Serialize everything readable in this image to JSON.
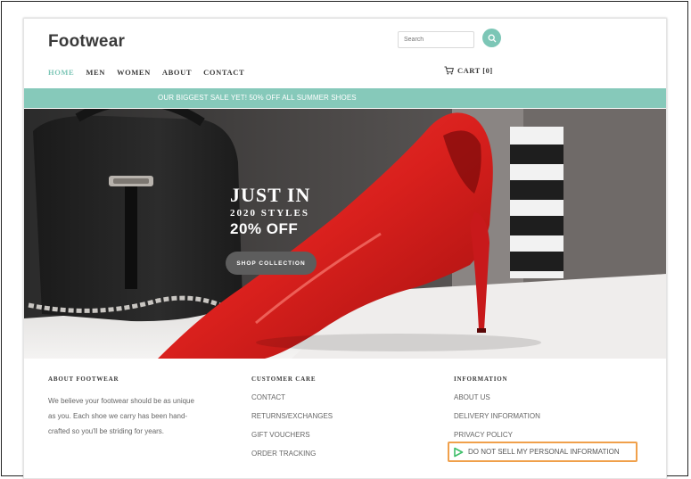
{
  "header": {
    "brand": "Footwear",
    "search_placeholder": "Search",
    "nav": [
      "HOME",
      "MEN",
      "WOMEN",
      "ABOUT",
      "CONTACT"
    ],
    "cart_label": "CART [0]"
  },
  "promo": {
    "text": "OUR BIGGEST SALE YET! 50% OFF ALL SUMMER SHOES"
  },
  "hero": {
    "title": "JUST IN",
    "subtitle": "2020 STYLES",
    "discount": "20% OFF",
    "cta": "SHOP COLLECTION"
  },
  "footer": {
    "about": {
      "heading": "ABOUT FOOTWEAR",
      "lines": [
        "We believe your footwear should be as unique",
        "as you. Each shoe we carry has been hand-",
        "crafted so you'll be striding for years."
      ]
    },
    "customer_care": {
      "heading": "CUSTOMER CARE",
      "links": [
        "CONTACT",
        "RETURNS/EXCHANGES",
        "GIFT VOUCHERS",
        "ORDER TRACKING"
      ]
    },
    "information": {
      "heading": "INFORMATION",
      "links": [
        "ABOUT US",
        "DELIVERY INFORMATION",
        "PRIVACY POLICY"
      ],
      "do_not_sell": "DO NOT SELL MY PERSONAL INFORMATION"
    }
  },
  "colors": {
    "accent": "#86c9ba",
    "highlight": "#f0a04b"
  }
}
